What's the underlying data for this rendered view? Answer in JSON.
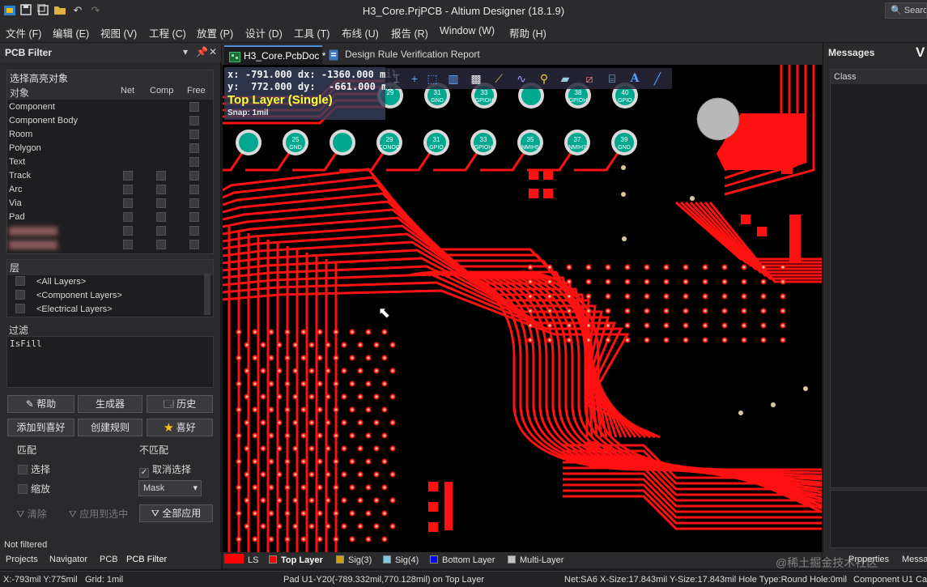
{
  "window": {
    "title": "H3_Core.PrjPCB - Altium Designer (18.1.9)",
    "search_placeholder": "Search"
  },
  "menu": [
    "文件 (F)",
    "编辑 (E)",
    "视图 (V)",
    "工程 (C)",
    "放置 (P)",
    "设计 (D)",
    "工具 (T)",
    "布线 (U)",
    "报告 (R)",
    "Window (W)",
    "帮助 (H)"
  ],
  "pcb_filter": {
    "title": "PCB Filter",
    "highlight_group": "选择高亮对象",
    "object_col": "对象",
    "col_net": "Net",
    "col_comp": "Comp",
    "col_free": "Free",
    "objects": [
      "Component",
      "Component Body",
      "Room",
      "Polygon",
      "Text",
      "Track",
      "Arc",
      "Via",
      "Pad"
    ],
    "layers_group": "层",
    "layers": [
      "<All Layers>",
      "<Component Layers>",
      "<Electrical Layers>"
    ],
    "filter_label": "过滤",
    "filter_text": "IsFill",
    "btn_help": "帮助",
    "btn_builder": "生成器",
    "btn_history": "历史",
    "btn_add_fav": "添加到喜好",
    "btn_create_rule": "创建规则",
    "btn_fav": "喜好",
    "match_label": "匹配",
    "nomatch_label": "不匹配",
    "match_select": "选择",
    "match_zoom": "缩放",
    "nomatch_deselect": "取消选择",
    "mask_value": "Mask",
    "btn_clear": "清除",
    "btn_apply_selected": "应用到选中",
    "btn_apply_all": "全部应用",
    "status": "Not filtered"
  },
  "bottom_tabs": [
    "Projects",
    "Navigator",
    "PCB",
    "PCB Filter"
  ],
  "doc_tabs": [
    {
      "label": "H3_Core.PcbDoc *",
      "active": true
    },
    {
      "label": "Design Rule Verification Report",
      "active": false
    }
  ],
  "hud": {
    "x_label": "x:",
    "x": "-791.000",
    "dx_label": "dx:",
    "dx": "-1360.000",
    "unit": "mil",
    "y_label": "y:",
    "y": "772.000",
    "dy_label": "dy:",
    "dy": "-661.000",
    "layer": "Top Layer (Single)",
    "snap": "Snap: 1mil"
  },
  "pads_top": [
    {
      "num": "29",
      "net": ""
    },
    {
      "num": "31",
      "net": "GND"
    },
    {
      "num": "33",
      "net": "GPIOH"
    },
    {
      "num": "",
      "net": ""
    },
    {
      "num": "38",
      "net": "GPIOH"
    },
    {
      "num": "40",
      "net": "GPIO"
    }
  ],
  "pads_row2": [
    {
      "num": "",
      "net": ""
    },
    {
      "num": "25",
      "net": "GND"
    },
    {
      "num": "",
      "net": ""
    },
    {
      "num": "29",
      "net": "CONOO"
    },
    {
      "num": "31",
      "net": "GPIO"
    },
    {
      "num": "33",
      "net": "GPIOH"
    },
    {
      "num": "35",
      "net": "NMIH5"
    },
    {
      "num": "37",
      "net": "NMIH7"
    },
    {
      "num": "39",
      "net": "GND"
    }
  ],
  "messages": {
    "title": "Messages",
    "col_class": "Class"
  },
  "layer_tabs": [
    {
      "label": "LS",
      "color": "#ff0000"
    },
    {
      "label": "Top Layer",
      "color": "#ff0000"
    },
    {
      "label": "Sig(3)",
      "color": "#c8a000"
    },
    {
      "label": "Sig(4)",
      "color": "#80c8e0"
    },
    {
      "label": "Bottom Layer",
      "color": "#0000ff"
    },
    {
      "label": "Multi-Layer",
      "color": "#c0c0c0"
    }
  ],
  "right_bottom_tabs": [
    "Properties",
    "Messa"
  ],
  "watermark": "@稀土掘金技术社区",
  "status_bar": {
    "coords": "X:-793mil Y:775mil",
    "grid": "Grid: 1mil",
    "pad_info": "Pad U1-Y20(-789.332mil,770.128mil) on Top Layer",
    "net_info": "Net:SA6 X-Size:17.843mil Y-Size:17.843mil Hole Type:Round Hole:0mil",
    "comp_info": "Component U1 Ca"
  },
  "colors": {
    "copper": "#ff1111",
    "pad_fill": "#d9d9d9",
    "pad_label": "#00a88f",
    "hud_layer": "#ffff33"
  }
}
